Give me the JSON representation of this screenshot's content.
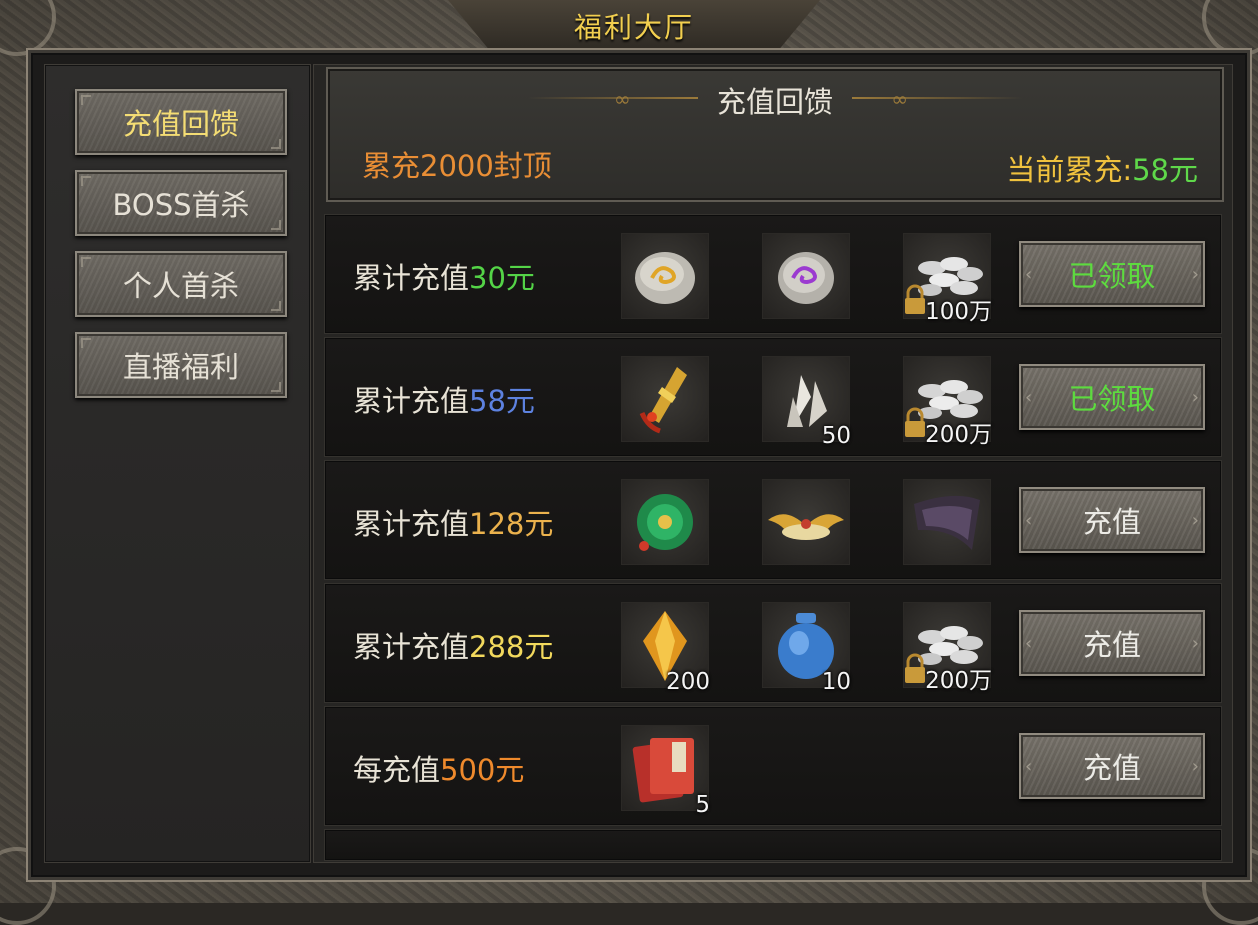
{
  "window": {
    "title": "福利大厅"
  },
  "sidebar": {
    "items": [
      {
        "label": "充值回馈",
        "active": true
      },
      {
        "label": "BOSS首杀"
      },
      {
        "label": "个人首杀"
      },
      {
        "label": "直播福利"
      }
    ]
  },
  "panel": {
    "title": "充值回馈",
    "cap": "累充2000封顶",
    "current_label": "当前累充:",
    "current_value": "58元"
  },
  "rows": [
    {
      "prefix": "累计充值",
      "amount": "30元",
      "items": [
        {
          "icon": "gold-swirl-stone-icon",
          "count": ""
        },
        {
          "icon": "purple-swirl-stone-icon",
          "count": ""
        },
        {
          "icon": "locked-silver-coins-icon",
          "count": "100万"
        }
      ],
      "button": "已领取"
    },
    {
      "prefix": "累计充值",
      "amount": "58元",
      "items": [
        {
          "icon": "golden-weapon-hilt-icon",
          "count": ""
        },
        {
          "icon": "white-crystal-icon",
          "count": "50"
        },
        {
          "icon": "locked-silver-coins-icon",
          "count": "200万"
        }
      ],
      "button": "已领取"
    },
    {
      "prefix": "累计充值",
      "amount": "128元",
      "items": [
        {
          "icon": "jade-pendant-icon",
          "count": ""
        },
        {
          "icon": "golden-wings-icon",
          "count": ""
        },
        {
          "icon": "dark-wing-icon",
          "count": ""
        }
      ],
      "button": "充值"
    },
    {
      "prefix": "累计充值",
      "amount": "288元",
      "items": [
        {
          "icon": "amber-crystal-icon",
          "count": "200"
        },
        {
          "icon": "blue-jar-icon",
          "count": "10"
        },
        {
          "icon": "locked-silver-coins-icon",
          "count": "200万"
        }
      ],
      "button": "充值"
    },
    {
      "prefix": "每充值",
      "amount": "500元",
      "items": [
        {
          "icon": "red-book-icon",
          "count": "5"
        }
      ],
      "button": "充值"
    }
  ],
  "colors": {
    "title": "#f2cf4f",
    "claimed": "#5ddb3f",
    "cap": "#e98e35"
  }
}
